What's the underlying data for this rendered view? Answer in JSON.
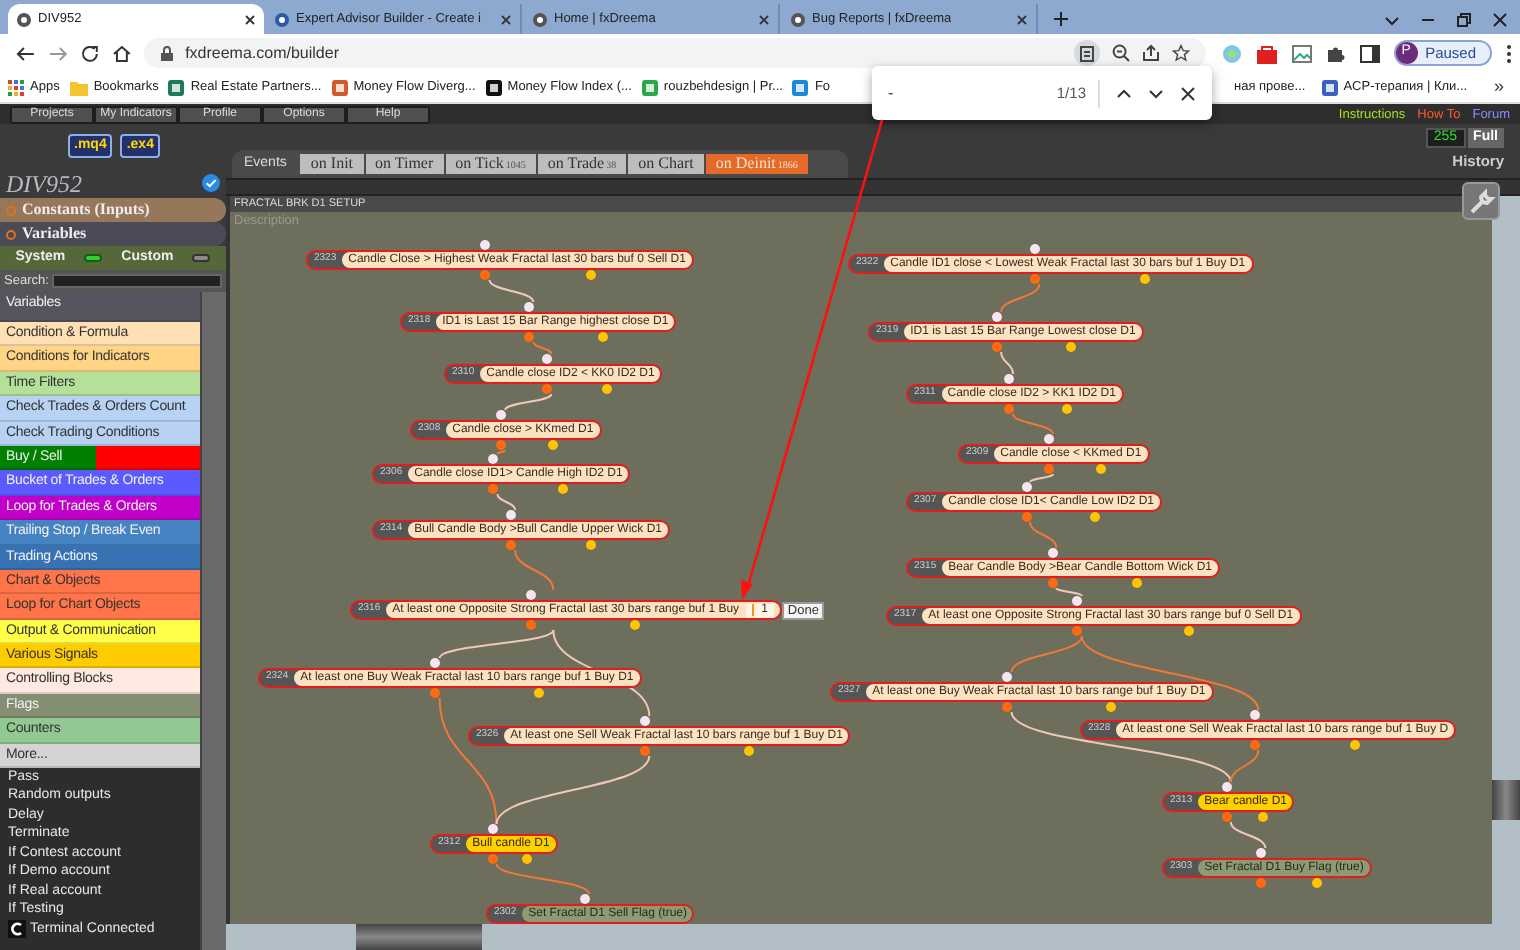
{
  "browser": {
    "tabs": [
      {
        "title": "DIV952",
        "selected": true
      },
      {
        "title": "Expert Advisor Builder - Create i",
        "selected": false
      },
      {
        "title": "Home | fxDreema",
        "selected": false
      },
      {
        "title": "Bug Reports | fxDreema",
        "selected": false
      }
    ],
    "address": "fxdreema.com/builder",
    "profile": {
      "initial": "P",
      "status": "Paused"
    },
    "bookmarks": [
      {
        "label": "Apps",
        "kind": "apps"
      },
      {
        "label": "Bookmarks",
        "kind": "folder"
      },
      {
        "label": "Real Estate Partners...",
        "kind": "site"
      },
      {
        "label": "Money Flow Diverg...",
        "kind": "site"
      },
      {
        "label": "Money Flow Index (...",
        "kind": "site"
      },
      {
        "label": "rouzbehdesign | Pr...",
        "kind": "site"
      },
      {
        "label": "Fo",
        "kind": "site"
      },
      {
        "label": "ная прове...",
        "kind": "plain"
      },
      {
        "label": "ACP-терапия | Кли...",
        "kind": "site"
      }
    ],
    "more_bookmarks": "»"
  },
  "find_bar": {
    "query": "-",
    "count": "1/13"
  },
  "app": {
    "menu": [
      "Projects",
      "My Indicators",
      "Profile",
      "Options",
      "Help"
    ],
    "links": [
      {
        "label": "Instructions",
        "color": "#a8e020"
      },
      {
        "label": "How To",
        "color": "#ff5a28"
      },
      {
        "label": "Forum",
        "color": "#8c8cff"
      }
    ],
    "file_buttons": [
      ".mq4",
      ".ex4"
    ],
    "counter": "255",
    "full_button": "Full",
    "history": "History"
  },
  "sidebar": {
    "project": "DIV952",
    "constants": "Constants (Inputs)",
    "variables": "Variables",
    "toggles": [
      {
        "label": "System",
        "on": true
      },
      {
        "label": "Custom",
        "on": false
      }
    ],
    "search_label": "Search:",
    "categories": [
      {
        "label": "Variables",
        "color": "#55555f"
      },
      {
        "label": "Condition & Formula",
        "color": "#ffdfb4"
      },
      {
        "label": "Conditions for Indicators",
        "color": "#ffd484"
      },
      {
        "label": "Time Filters",
        "color": "#b4e09a"
      },
      {
        "label": "Check Trades & Orders Count",
        "color": "#b8d2f4"
      },
      {
        "label": "Check Trading Conditions",
        "color": "#b8d2f4"
      },
      {
        "label": "Buy / Sell",
        "color": "#008000",
        "swatch": {
          "color": "#ff0000"
        }
      },
      {
        "label": "Bucket of Trades & Orders",
        "color": "#5a5aff"
      },
      {
        "label": "Loop for Trades & Orders",
        "color": "#c000c8"
      },
      {
        "label": "Trailing Stop / Break Even",
        "color": "#4683c2"
      },
      {
        "label": "Trading Actions",
        "color": "#3672b4"
      },
      {
        "label": "Chart & Objects",
        "color": "#ff7448"
      },
      {
        "label": "Loop for Chart Objects",
        "color": "#ff7448"
      },
      {
        "label": "Output & Communication",
        "color": "#ffff48"
      },
      {
        "label": "Various Signals",
        "color": "#ffcc00"
      },
      {
        "label": "Controlling Blocks",
        "color": "#ffe9e0"
      },
      {
        "label": "Flags",
        "color": "#848e72"
      },
      {
        "label": "Counters",
        "color": "#92c892"
      },
      {
        "label": "More...",
        "color": "#d4d4d4"
      }
    ],
    "blocks": [
      "Pass",
      "Random outputs",
      "Delay",
      "Terminate",
      "If Contest account",
      "If Demo account",
      "If Real account",
      "If Testing",
      "Terminal Connected"
    ]
  },
  "events": {
    "label": "Events",
    "tabs": [
      {
        "label": "on Init",
        "selected": false
      },
      {
        "label": "on Timer",
        "selected": false
      },
      {
        "label": "on Tick",
        "count": "1045",
        "selected": false
      },
      {
        "label": "on Trade",
        "count": "38",
        "selected": false
      },
      {
        "label": "on Chart",
        "selected": false
      },
      {
        "label": "on Deinit",
        "count": "1866",
        "selected": true
      }
    ]
  },
  "canvas": {
    "title": "FRACTAL BRK D1 SETUP",
    "description": "Description",
    "blocks": [
      {
        "id": "2323",
        "text": "Candle Close > Highest Weak Fractal last 30 bars buf 0 Sell D1",
        "kind": "condition"
      },
      {
        "id": "2318",
        "text": "ID1 is Last 15 Bar Range highest close D1",
        "kind": "condition"
      },
      {
        "id": "2310",
        "text": "Candle close ID2 < KK0 ID2 D1",
        "kind": "condition"
      },
      {
        "id": "2308",
        "text": "Candle close > KKmed D1",
        "kind": "condition"
      },
      {
        "id": "2306",
        "text": "Candle close ID1> Candle High ID2 D1",
        "kind": "condition"
      },
      {
        "id": "2314",
        "text": "Bull Candle Body >Bull Candle Upper Wick D1",
        "kind": "condition"
      },
      {
        "id": "2316",
        "text": "At least one Opposite Strong Fractal last 30 bars range buf 1 Buy",
        "kind": "condition",
        "edit": {
          "value": "1",
          "button": "Done"
        }
      },
      {
        "id": "2324",
        "text": "At least one Buy Weak Fractal last 10 bars range buf 1 Buy D1",
        "kind": "condition"
      },
      {
        "id": "2326",
        "text": "At least one Sell Weak Fractal last 10 bars range buf 1 Buy D1",
        "kind": "condition"
      },
      {
        "id": "2312",
        "text": "Bull candle D1",
        "kind": "action"
      },
      {
        "id": "2302",
        "text": "Set Fractal D1 Sell Flag (true)",
        "kind": "flag"
      },
      {
        "id": "2322",
        "text": "Candle ID1 close < Lowest Weak Fractal last 30 bars buf 1 Buy D1",
        "kind": "condition"
      },
      {
        "id": "2319",
        "text": "ID1 is Last 15 Bar Range Lowest close D1",
        "kind": "condition"
      },
      {
        "id": "2311",
        "text": "Candle close ID2 > KK1 ID2 D1",
        "kind": "condition"
      },
      {
        "id": "2309",
        "text": "Candle close < KKmed D1",
        "kind": "condition"
      },
      {
        "id": "2307",
        "text": "Candle close ID1< Candle Low ID2 D1",
        "kind": "condition"
      },
      {
        "id": "2315",
        "text": "Bear Candle Body >Bear Candle Bottom Wick D1",
        "kind": "condition"
      },
      {
        "id": "2317",
        "text": "At least one Opposite Strong Fractal last 30 bars range buf 0 Sell D1",
        "kind": "condition"
      },
      {
        "id": "2327",
        "text": "At least one Buy Weak Fractal last 10 bars range buf 1 Buy D1",
        "kind": "condition"
      },
      {
        "id": "2328",
        "text": "At least one Sell Weak Fractal last 10 bars range buf 1 Buy D",
        "kind": "condition"
      },
      {
        "id": "2313",
        "text": "Bear candle D1",
        "kind": "action"
      },
      {
        "id": "2303",
        "text": "Set Fractal D1 Buy Flag (true)",
        "kind": "flag"
      }
    ]
  }
}
